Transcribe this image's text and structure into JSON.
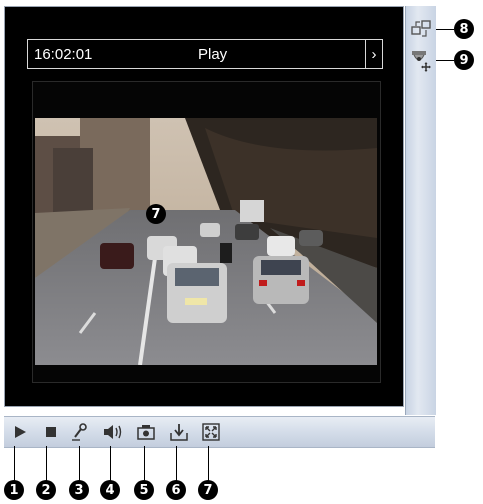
{
  "status_bar": {
    "time": "16:02:01",
    "state": "Play",
    "next_arrow": "›"
  },
  "toolbar": {
    "buttons": [
      {
        "id": "play",
        "icon": "play-icon"
      },
      {
        "id": "stop",
        "icon": "stop-icon"
      },
      {
        "id": "talk",
        "icon": "microphone-icon"
      },
      {
        "id": "audio",
        "icon": "speaker-icon"
      },
      {
        "id": "snapshot",
        "icon": "camera-icon"
      },
      {
        "id": "record",
        "icon": "save-record-icon"
      },
      {
        "id": "fullscreen",
        "icon": "fullscreen-icon"
      }
    ]
  },
  "side_panel": {
    "buttons": [
      {
        "id": "switch-view",
        "icon": "switch-view-icon"
      },
      {
        "id": "ptz-control",
        "icon": "ptz-camera-icon"
      }
    ]
  },
  "callouts": {
    "c1": "1",
    "c2": "2",
    "c3": "3",
    "c4": "4",
    "c5": "5",
    "c6": "6",
    "c7": "7",
    "video_marker": "7",
    "c8": "8",
    "c9": "9"
  },
  "colors": {
    "frame": "#000000",
    "toolbar": "#d2dbe8",
    "side_panel": "#d6dfeb",
    "callout": "#000000"
  }
}
